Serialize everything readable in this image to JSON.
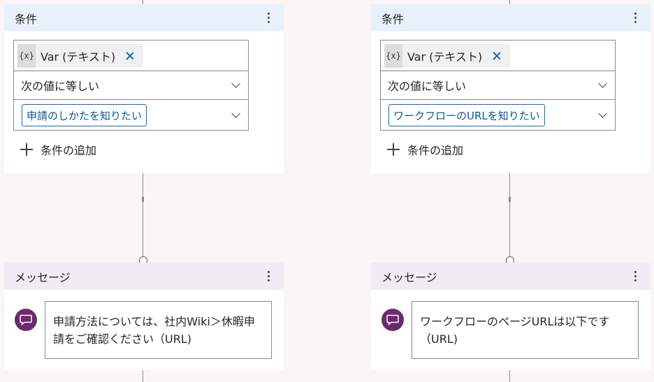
{
  "flows": [
    {
      "condition": {
        "title": "条件",
        "variable": "Var (テキスト)",
        "operator": "次の値に等しい",
        "value": "申請のしかたを知りたい",
        "add_label": "条件の追加"
      },
      "message": {
        "title": "メッセージ",
        "text": "申請方法については、社内Wiki＞休暇申請をご確認ください（URL)"
      }
    },
    {
      "condition": {
        "title": "条件",
        "variable": "Var (テキスト)",
        "operator": "次の値に等しい",
        "value": "ワークフローのURLを知りたい",
        "add_label": "条件の追加"
      },
      "message": {
        "title": "メッセージ",
        "text": "ワークフローのページURLは以下です（URL)"
      }
    }
  ],
  "icons": {
    "var": "{x}",
    "more": "more-vertical",
    "remove": "dismiss",
    "dropdown": "chevron-down",
    "add": "plus",
    "message": "chat-bubble"
  },
  "colors": {
    "condition_header": "#e8f1fb",
    "message_header": "#f1ebf3",
    "accent": "#0f6cbd",
    "message_icon": "#6b2a6b"
  }
}
